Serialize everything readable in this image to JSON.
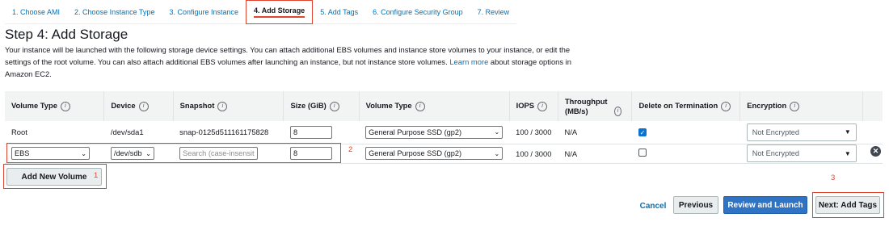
{
  "tabs": [
    {
      "label": "1. Choose AMI"
    },
    {
      "label": "2. Choose Instance Type"
    },
    {
      "label": "3. Configure Instance"
    },
    {
      "label": "4. Add Storage"
    },
    {
      "label": "5. Add Tags"
    },
    {
      "label": "6. Configure Security Group"
    },
    {
      "label": "7. Review"
    }
  ],
  "heading": "Step 4: Add Storage",
  "description": {
    "part1": "Your instance will be launched with the following storage device settings. You can attach additional EBS volumes and instance store volumes to your instance, or edit the settings of the root volume. You can also attach additional EBS volumes after launching an instance, but not instance store volumes. ",
    "link": "Learn more",
    "part2": " about storage options in Amazon EC2."
  },
  "table": {
    "columns": [
      "Volume Type",
      "Device",
      "Snapshot",
      "Size (GiB)",
      "Volume Type",
      "IOPS",
      "Throughput (MB/s)",
      "Delete on Termination",
      "Encryption"
    ],
    "rows": [
      {
        "volume_type": "Root",
        "device": "/dev/sda1",
        "snapshot": "snap-0125d511161175828",
        "size": "8",
        "type": "General Purpose SSD (gp2)",
        "iops": "100 / 3000",
        "throughput": "N/A",
        "delete_on_termination": true,
        "encryption": "Not Encrypted"
      },
      {
        "volume_type": "EBS",
        "device": "/dev/sdb",
        "snapshot_placeholder": "Search (case-insensit",
        "size": "8",
        "type": "General Purpose SSD (gp2)",
        "iops": "100 / 3000",
        "throughput": "N/A",
        "delete_on_termination": false,
        "encryption": "Not Encrypted"
      }
    ]
  },
  "buttons": {
    "add_new_volume": "Add New Volume",
    "cancel": "Cancel",
    "previous": "Previous",
    "review_and_launch": "Review and Launch",
    "next": "Next: Add Tags"
  },
  "annotations": [
    "1",
    "2",
    "3"
  ],
  "icons": {
    "info": "info-icon",
    "remove": "remove-row-icon",
    "check": "checkmark-icon",
    "dropdown": "chevron-down-icon"
  },
  "colors": {
    "link": "#0073bb",
    "primary_button": "#2e73c4",
    "annotation": "#e0452f",
    "header_bg": "#f2f3f3"
  }
}
